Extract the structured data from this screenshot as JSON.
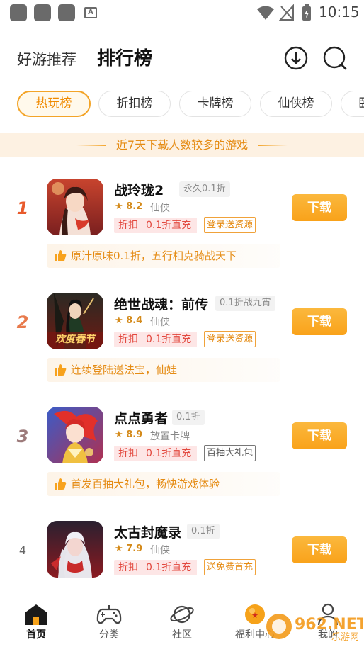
{
  "status_bar": {
    "time": "10:15"
  },
  "header": {
    "subtitle": "好游推荐",
    "title": "排行榜",
    "icons": [
      "download-icon",
      "search-icon"
    ]
  },
  "tabs": [
    {
      "label": "热玩榜",
      "active": true
    },
    {
      "label": "折扣榜",
      "active": false
    },
    {
      "label": "卡牌榜",
      "active": false
    },
    {
      "label": "仙侠榜",
      "active": false
    },
    {
      "label": "卧",
      "active": false
    }
  ],
  "banner": {
    "text": "近7天下载人数较多的游戏"
  },
  "games": [
    {
      "rank": "1",
      "name": "战玲珑2",
      "name_tag": "永久0.1折",
      "rating": "8.2",
      "genre": "仙侠",
      "discount_label": "折扣",
      "offer": "0.1折直充",
      "promo": "登录送资源",
      "recommendation": "原汁原味0.1折，五行相克骑战天下",
      "download_label": "下载"
    },
    {
      "rank": "2",
      "name": "绝世战魂：前传",
      "name_tag": "0.1折战九宵",
      "rating": "8.4",
      "genre": "仙侠",
      "discount_label": "折扣",
      "offer": "0.1折直充",
      "promo": "登录送资源",
      "recommendation": "连续登陆送法宝，仙娃",
      "download_label": "下载",
      "icon_caption": "欢度春节"
    },
    {
      "rank": "3",
      "name": "点点勇者",
      "name_tag": "0.1折",
      "rating": "8.9",
      "genre": "放置卡牌",
      "discount_label": "折扣",
      "offer": "0.1折直充",
      "promo": "百抽大礼包",
      "recommendation": "首发百抽大礼包，畅快游戏体验",
      "download_label": "下载"
    },
    {
      "rank": "4",
      "name": "太古封魔录",
      "name_tag": "0.1折",
      "rating": "7.9",
      "genre": "仙侠",
      "discount_label": "折扣",
      "offer": "0.1折直充",
      "promo": "送免费首充",
      "download_label": "下载"
    }
  ],
  "bottom_nav": [
    {
      "label": "首页",
      "icon": "home-icon",
      "active": true
    },
    {
      "label": "分类",
      "icon": "gamepad-icon",
      "active": false
    },
    {
      "label": "社区",
      "icon": "planet-icon",
      "active": false
    },
    {
      "label": "福利中心",
      "icon": "dragonball-icon",
      "active": false
    },
    {
      "label": "我的",
      "icon": "person-icon",
      "active": false
    }
  ],
  "watermark": {
    "brand": "962.NET",
    "sub": "乐游网"
  },
  "colors": {
    "accent": "#f9a21a",
    "accent_text": "#e58b13",
    "rank_1": "#e85a2c",
    "rank_2": "#e87a4c",
    "rank_3": "#9c7a7a",
    "discount_red": "#e2483e"
  }
}
